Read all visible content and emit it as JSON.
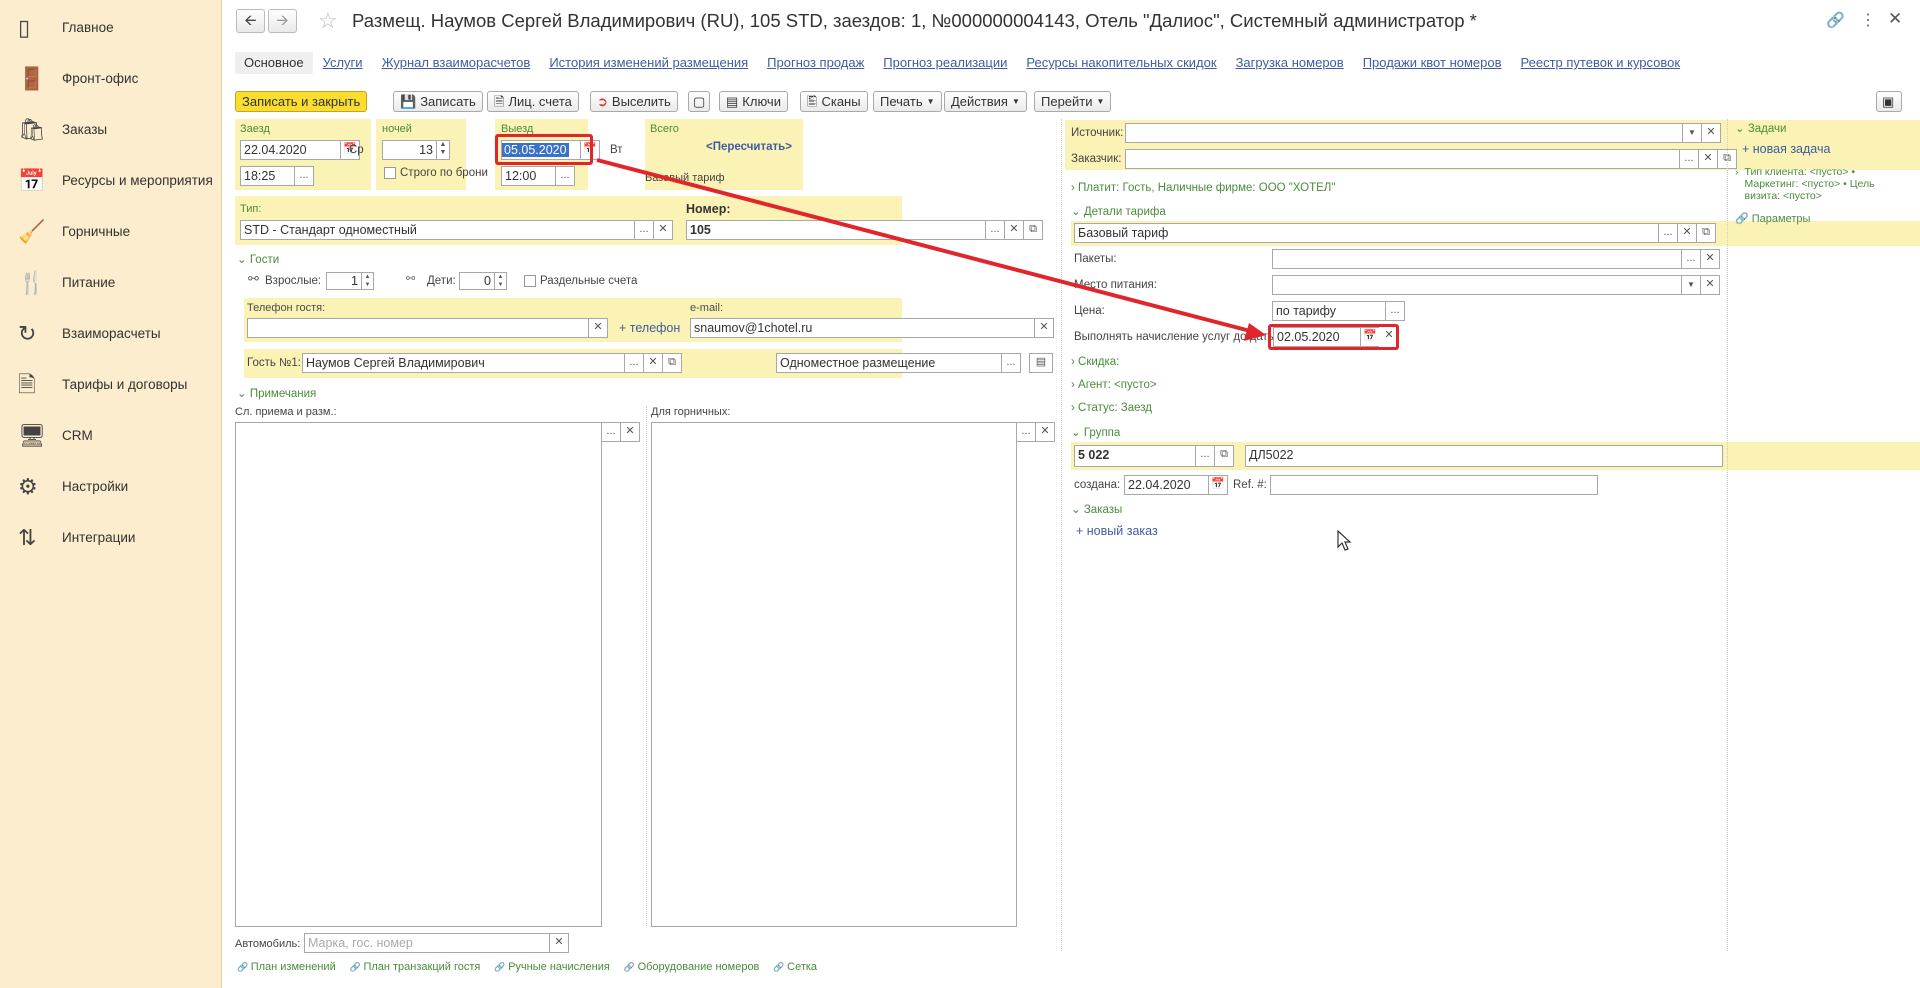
{
  "sidebar": {
    "items": [
      {
        "label": "Главное",
        "icon": "bar-chart-icon"
      },
      {
        "label": "Фронт-офис",
        "icon": "door-icon"
      },
      {
        "label": "Заказы",
        "icon": "shopping-bag-icon"
      },
      {
        "label": "Ресурсы и мероприятия",
        "icon": "calendar-icon"
      },
      {
        "label": "Горничные",
        "icon": "vacuum-cleaner-icon"
      },
      {
        "label": "Питание",
        "icon": "cutlery-icon"
      },
      {
        "label": "Взаиморасчеты",
        "icon": "coins-cycle-icon"
      },
      {
        "label": "Тарифы и договоры",
        "icon": "document-stack-icon"
      },
      {
        "label": "CRM",
        "icon": "crm-monitor-icon"
      },
      {
        "label": "Настройки",
        "icon": "gears-icon"
      },
      {
        "label": "Интеграции",
        "icon": "integration-arrows-icon"
      }
    ]
  },
  "header": {
    "title": "Размещ. Наумов Сергей Владимирович (RU), 105 STD, заездов: 1, №000000004143, Отель \"Далиос\", Системный администратор *"
  },
  "tabs": [
    "Основное",
    "Услуги",
    "Журнал взаиморасчетов",
    "История изменений размещения",
    "Прогноз продаж",
    "Прогноз реализации",
    "Ресурсы накопительных скидок",
    "Загрузка номеров",
    "Продажи квот номеров",
    "Реестр путевок и курсовок"
  ],
  "toolbar": {
    "save_close": "Записать и закрыть",
    "save": "Записать",
    "accounts": "Лиц. счета",
    "checkout": "Выселить",
    "keys": "Ключи",
    "scans": "Сканы",
    "print": "Печать",
    "actions": "Действия",
    "goto": "Перейти"
  },
  "stay": {
    "checkin_label": "Заезд",
    "checkin_date": "22.04.2020",
    "checkin_dow": "Ср",
    "checkin_time": "18:25",
    "nights_label": "ночей",
    "nights": "13",
    "strict_label": "Строго по брони",
    "checkout_label": "Выезд",
    "checkout_date": "05.05.2020",
    "checkout_dow": "Вт",
    "checkout_time": "12:00",
    "total_label": "Всего",
    "recalc": "<Пересчитать>",
    "base_rate": "Базовый тариф"
  },
  "room": {
    "type_label": "Тип:",
    "type_value": "STD - Стандарт одноместный",
    "number_label": "Номер:",
    "number_value": "105"
  },
  "guests": {
    "section": "Гости",
    "adults_label": "Взрослые:",
    "adults": "1",
    "children_label": "Дети:",
    "children": "0",
    "separate_label": "Раздельные счета",
    "phone_label": "Телефон гостя:",
    "phone_value": "",
    "add_phone": "+ телефон",
    "email_label": "e-mail:",
    "email_value": "snaumov@1chotel.ru",
    "guest_label": "Гость №1:",
    "guest_name": "Наумов Сергей Владимирович",
    "accommodation": "Одноместное размещение"
  },
  "notes": {
    "section": "Примечания",
    "reception_label": "Сл. приема и разм.:",
    "maid_label": "Для горничных:"
  },
  "car": {
    "label": "Автомобиль:",
    "placeholder": "Марка, гос. номер"
  },
  "bottom_links": [
    "План изменений",
    "План транзакций гостя",
    "Ручные начисления",
    "Оборудование номеров",
    "Сетка"
  ],
  "right": {
    "source_label": "Источник:",
    "customer_label": "Заказчик:",
    "payer": "Платит: Гость, Наличные фирме: ООО \"ХОТЕЛ\"",
    "rate_section": "Детали тарифа",
    "rate_value": "Базовый тариф",
    "packages_label": "Пакеты:",
    "meals_label": "Место питания:",
    "price_label": "Цена:",
    "price_value": "по тарифу",
    "charge_until_label": "Выполнять начисление услуг до даты:",
    "charge_until_value": "02.05.2020",
    "discount": "Скидка:",
    "agent": "Агент: <пусто>",
    "status": "Статус: Заезд",
    "group_section": "Группа",
    "group_code": "5 022",
    "group_name": "ДЛ5022",
    "created_label": "создана:",
    "created_date": "22.04.2020",
    "ref_label": "Ref. #:",
    "orders_section": "Заказы",
    "new_order": "+ новый заказ"
  },
  "tasks": {
    "section": "Задачи",
    "new_task": "+ новая задача",
    "client_info": "Тип клиента: <пусто> • Маркетинг: <пусто> • Цель визита: <пусто>",
    "params": "Параметры"
  },
  "colors": {
    "accent": "#fbdd30",
    "highlight": "#e0262b",
    "link": "#3e5d9f",
    "green": "#4b8b3b",
    "panel": "#fbf3b5"
  }
}
